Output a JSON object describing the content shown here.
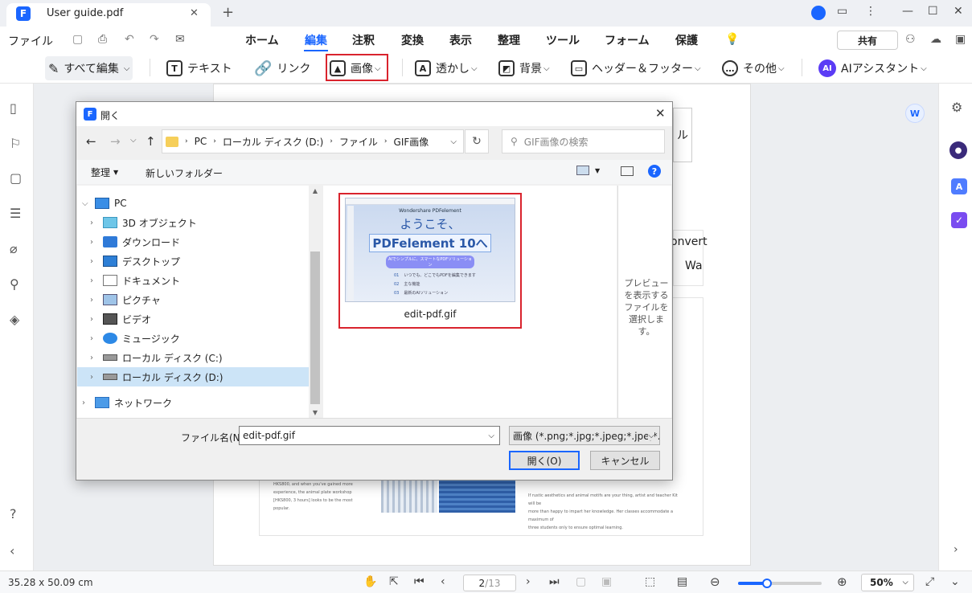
{
  "titlebar": {
    "tab_title": "User guide.pdf",
    "close": "✕",
    "new_tab": "+"
  },
  "menu": {
    "file": "ファイル",
    "tabs": [
      "ホーム",
      "編集",
      "注釈",
      "変換",
      "表示",
      "整理",
      "ツール",
      "フォーム",
      "保護"
    ],
    "active": "編集",
    "share": "共有"
  },
  "toolbar": {
    "edit_all": "すべて編集",
    "text": "テキスト",
    "link": "リンク",
    "image": "画像",
    "watermark": "透かし",
    "background": "背景",
    "header_footer": "ヘッダー＆フッター",
    "other": "その他",
    "ai": "AIアシスタント",
    "ai_badge": "AI",
    "chev": "⌵"
  },
  "dialog": {
    "title": "開く",
    "breadcrumb": [
      "PC",
      "ローカル ディスク (D:)",
      "ファイル",
      "GIF画像"
    ],
    "search_placeholder": "GIF画像の検索",
    "organize": "整理",
    "new_folder": "新しいフォルダー",
    "tree": [
      {
        "label": "PC",
        "level": 0,
        "expanded": true,
        "icon": "pc-icon"
      },
      {
        "label": "3D オブジェクト",
        "level": 1,
        "icon": "cube-icon"
      },
      {
        "label": "ダウンロード",
        "level": 1,
        "icon": "download-icon"
      },
      {
        "label": "デスクトップ",
        "level": 1,
        "icon": "desktop-icon"
      },
      {
        "label": "ドキュメント",
        "level": 1,
        "icon": "document-icon"
      },
      {
        "label": "ピクチャ",
        "level": 1,
        "icon": "pictures-icon"
      },
      {
        "label": "ビデオ",
        "level": 1,
        "icon": "video-icon"
      },
      {
        "label": "ミュージック",
        "level": 1,
        "icon": "music-icon"
      },
      {
        "label": "ローカル ディスク (C:)",
        "level": 1,
        "icon": "drive-icon"
      },
      {
        "label": "ローカル ディスク (D:)",
        "level": 1,
        "icon": "drive-icon",
        "selected": true
      },
      {
        "label": "ネットワーク",
        "level": 0,
        "icon": "network-icon"
      }
    ],
    "file": {
      "name": "edit-pdf.gif",
      "thumb_app": "Wondershare PDFelement",
      "thumb_welcome": "ようこそ、",
      "thumb_product": "PDFelement 10へ",
      "thumb_tagline": "AIでシンプルに、スマートなPDFソリューション",
      "thumb_items": [
        "いつでも、どこでもPDFを編集できます",
        "主な機能",
        "最新のAIソリューション"
      ],
      "thumb_nums": [
        "01",
        "02",
        "03"
      ]
    },
    "preview_text": "プレビューを表示するファイルを選択します。",
    "filename_label": "ファイル名(N):",
    "filename_value": "edit-pdf.gif",
    "filter": "画像 (*.png;*.jpg;*.jpeg;*.jpe;*.j",
    "open_btn": "開く(O)",
    "cancel_btn": "キャンセル"
  },
  "document": {
    "text_left": [
      "HKS800, and when you've gained more",
      "experience, the animal plate workshop",
      "[HKS800, 3 hours] looks to be the most popular."
    ],
    "text_right": [
      "If rustic aesthetics and animal motifs are your thing, artist and teacher Kit will be",
      "more than happy to impart her knowledge. Her classes accommodate a maximum of",
      "three students only to ensure optimal learning."
    ],
    "snippet_convert": "onvert",
    "snippet_wa": "Wa",
    "snippet_ru": "ル"
  },
  "statusbar": {
    "dimensions": "35.28 x 50.09 cm",
    "page_current": "2",
    "page_total": "/13",
    "zoom": "50%",
    "zoom_level": 0.35
  },
  "colors": {
    "accent": "#1a66ff",
    "highlight": "#d9232d"
  }
}
